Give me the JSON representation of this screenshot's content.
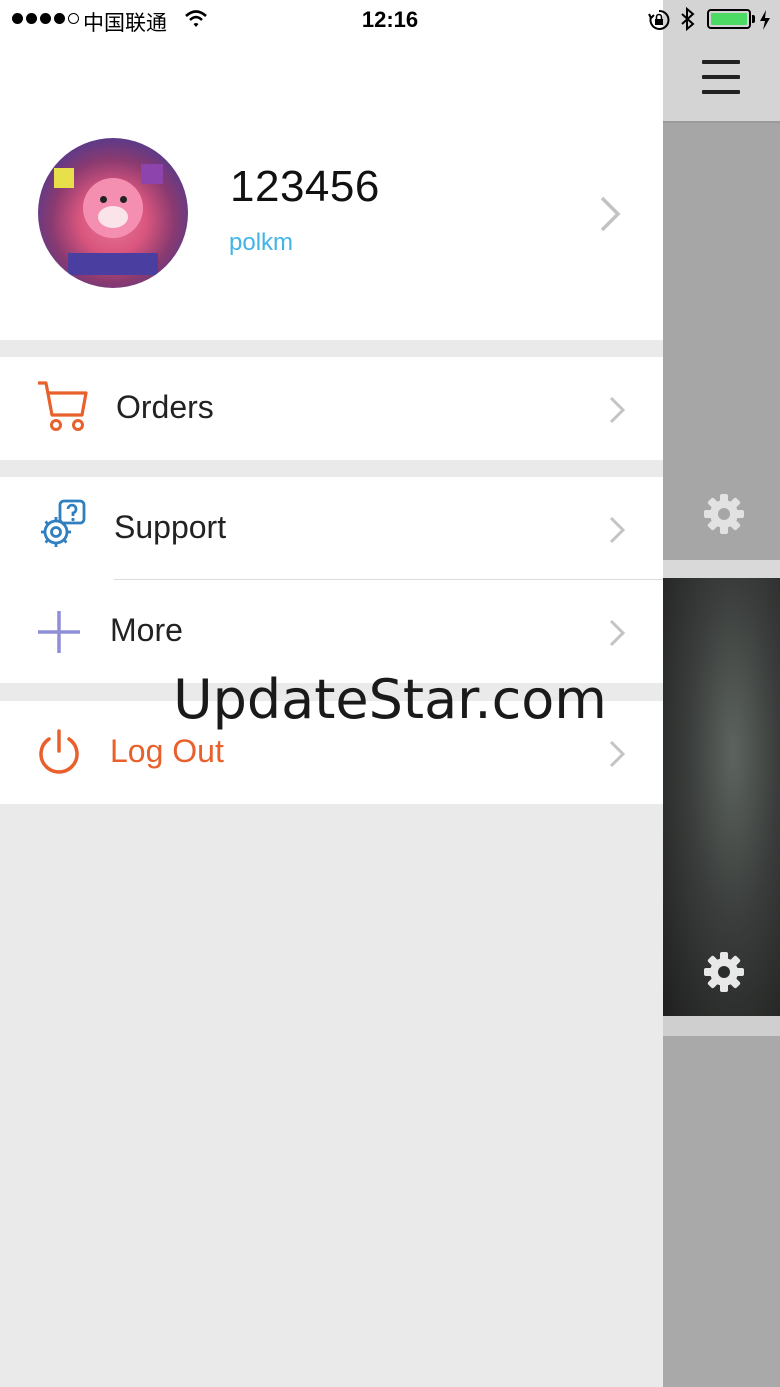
{
  "status_bar": {
    "carrier": "中国联通",
    "time": "12:16",
    "signal_dots_filled": 4,
    "signal_dots_total": 5,
    "battery_level": 1.0,
    "icons": [
      "wifi-icon",
      "orientation-lock-icon",
      "bluetooth-icon",
      "battery-icon",
      "charging-icon"
    ]
  },
  "profile": {
    "name": "123456",
    "subtitle": "polkm",
    "subtitle_color": "#42b4e6"
  },
  "menu": {
    "orders": {
      "label": "Orders",
      "icon": "cart-icon",
      "color": "#e8602c"
    },
    "support": {
      "label": "Support",
      "icon": "support-gear-icon",
      "color": "#2f7fc1"
    },
    "more": {
      "label": "More",
      "icon": "plus-icon",
      "color": "#8f8fd9"
    },
    "logout": {
      "label": "Log Out",
      "icon": "power-icon",
      "color": "#e8602c"
    }
  },
  "watermark": "UpdateStar.com",
  "background_app": {
    "icons": [
      "hamburger-menu-icon",
      "settings-gear-icon",
      "settings-gear-icon"
    ]
  }
}
